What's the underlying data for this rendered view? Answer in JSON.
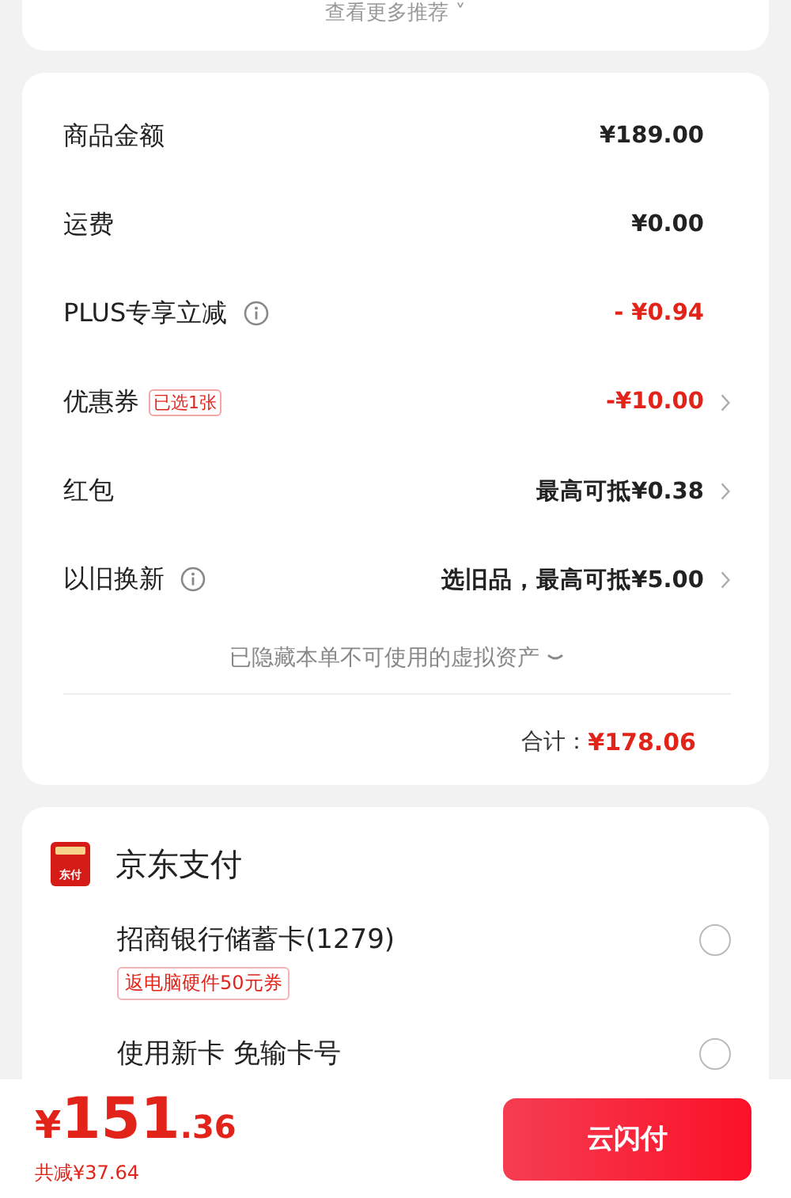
{
  "recommend_link": "查看更多推荐 ˅",
  "fees": [
    {
      "label": "商品金额",
      "value": "¥189.00",
      "kind": "amount"
    },
    {
      "label": "运费",
      "value": "¥0.00",
      "kind": "amount"
    },
    {
      "label": "PLUS专享立减",
      "info": true,
      "value": "- ¥0.94",
      "kind": "discount"
    },
    {
      "label": "优惠券",
      "tag": "已选1张",
      "value": "-¥10.00",
      "kind": "discount",
      "chevron": true
    },
    {
      "label": "红包",
      "value": "最高可抵¥0.38",
      "kind": "amount",
      "chevron": true
    },
    {
      "label": "以旧换新",
      "info": true,
      "value": "选旧品，最高可抵¥5.00",
      "kind": "amount",
      "chevron": true
    }
  ],
  "hidden_assets": "已隐藏本单不可使用的虚拟资产",
  "total": {
    "label": "合计：",
    "value": "¥178.06"
  },
  "payment": {
    "title": "京东支付",
    "logo_text": "东付",
    "options": [
      {
        "name": "招商银行储蓄卡(1279)",
        "tag": "返电脑硬件50元券",
        "selected": false
      },
      {
        "name": "使用新卡 免输卡号",
        "selected": false
      }
    ]
  },
  "footer": {
    "currency": "¥",
    "amount_int": "151",
    "amount_dec": ".36",
    "saved": "共减¥37.64",
    "pay_button": "云闪付"
  }
}
